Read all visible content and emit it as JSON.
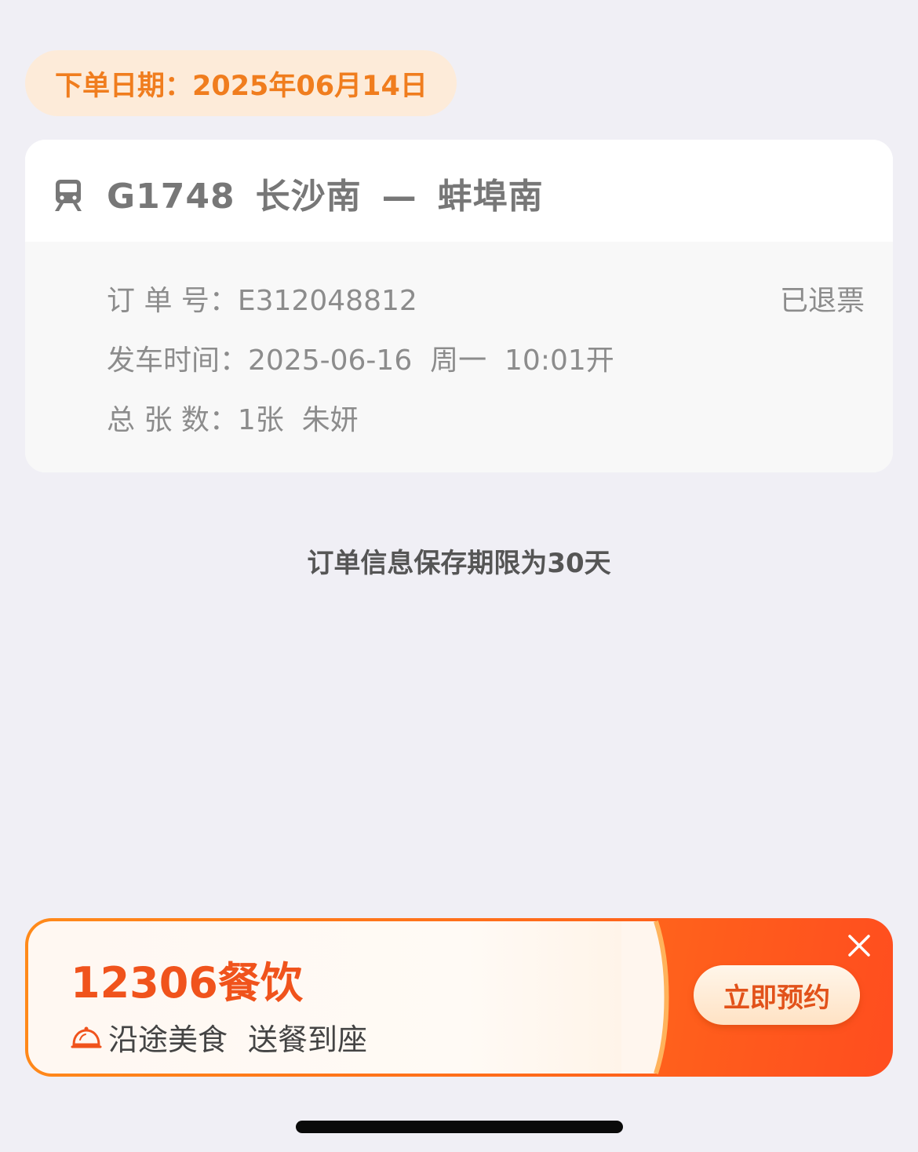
{
  "order_date": {
    "text": "下单日期：2025年06月14日"
  },
  "order_card": {
    "train_number": "G1748",
    "departure_station": "长沙南",
    "separator": "—",
    "arrival_station": "蚌埠南",
    "status": "已退票",
    "rows": [
      {
        "label": "订 单 号：",
        "value": "E312048812"
      },
      {
        "label": "发车时间：",
        "value": "2025-06-16  周一  10:01开"
      },
      {
        "label": "总 张 数：",
        "value": "1张  朱妍"
      }
    ]
  },
  "retention_note": "订单信息保存期限为30天",
  "banner": {
    "title": "12306餐饮",
    "subtitle_1": "沿途美食",
    "subtitle_2": "送餐到座",
    "button_label": "立即预约",
    "accent_color": "#ff6a1a",
    "title_color": "#f0531c"
  },
  "icons": {
    "train": "train-icon",
    "bell": "meal-cloche-icon",
    "close": "close-icon"
  }
}
